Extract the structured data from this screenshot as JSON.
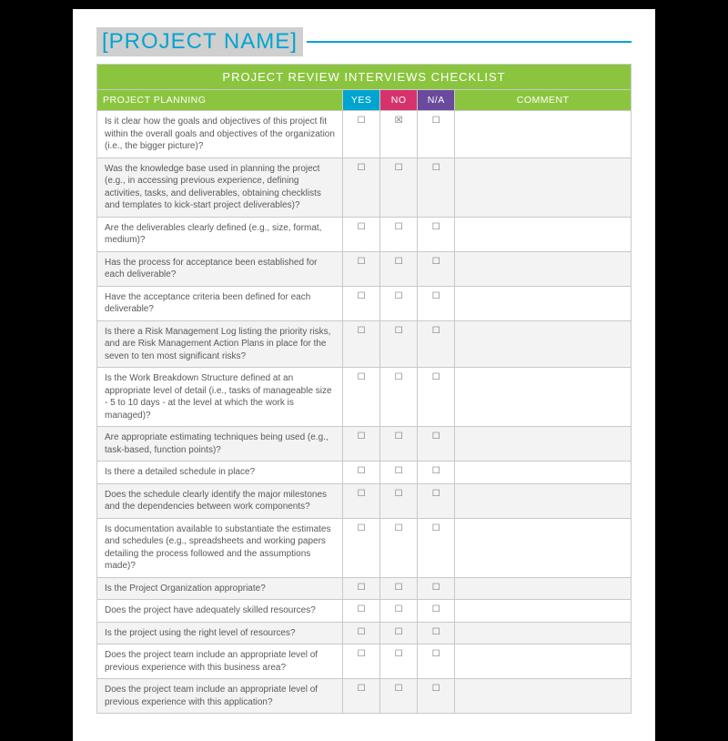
{
  "title": "[PROJECT NAME]",
  "banner": "PROJECT REVIEW INTERVIEWS CHECKLIST",
  "headers": {
    "section": "PROJECT PLANNING",
    "yes": "YES",
    "no": "NO",
    "na": "N/A",
    "comment": "COMMENT"
  },
  "glyphs": {
    "unchecked": "☐",
    "checked": "☒"
  },
  "rows": [
    {
      "q": "Is it clear how the goals and objectives of this project fit within the overall goals and objectives of the organization (i.e., the bigger picture)?",
      "yes": false,
      "no": true,
      "na": false,
      "alt": false
    },
    {
      "q": "Was the knowledge base used in planning the project (e.g., in accessing previous experience, defining activities, tasks, and deliverables, obtaining checklists and templates to kick-start project deliverables)?",
      "yes": false,
      "no": false,
      "na": false,
      "alt": true
    },
    {
      "q": "Are the deliverables clearly defined (e.g., size, format, medium)?",
      "yes": false,
      "no": false,
      "na": false,
      "alt": false
    },
    {
      "q": "Has the process for acceptance been established for each deliverable?",
      "yes": false,
      "no": false,
      "na": false,
      "alt": true
    },
    {
      "q": "Have the acceptance criteria been defined for each deliverable?",
      "yes": false,
      "no": false,
      "na": false,
      "alt": false
    },
    {
      "q": "Is there a Risk Management Log listing the priority risks, and are Risk Management Action Plans in place for the seven to ten most significant risks?",
      "yes": false,
      "no": false,
      "na": false,
      "alt": true
    },
    {
      "q": "Is the Work Breakdown Structure defined at an appropriate level of detail (i.e., tasks of manageable size - 5 to 10 days - at the level at which the work is managed)?",
      "yes": false,
      "no": false,
      "na": false,
      "alt": false
    },
    {
      "q": "Are appropriate estimating techniques being used (e.g., task-based, function points)?",
      "yes": false,
      "no": false,
      "na": false,
      "alt": true
    },
    {
      "q": "Is there a detailed schedule in place?",
      "yes": false,
      "no": false,
      "na": false,
      "alt": false
    },
    {
      "q": "Does the schedule clearly identify the major milestones and the dependencies between work components?",
      "yes": false,
      "no": false,
      "na": false,
      "alt": true
    },
    {
      "q": "Is documentation available to substantiate the estimates and schedules (e.g., spreadsheets and working papers detailing the process followed and the assumptions made)?",
      "yes": false,
      "no": false,
      "na": false,
      "alt": false
    },
    {
      "q": "Is the Project Organization appropriate?",
      "yes": false,
      "no": false,
      "na": false,
      "alt": true
    },
    {
      "q": "Does the project have adequately skilled resources?",
      "yes": false,
      "no": false,
      "na": false,
      "alt": false
    },
    {
      "q": "Is the project using the right level of resources?",
      "yes": false,
      "no": false,
      "na": false,
      "alt": true
    },
    {
      "q": "Does the project team include an appropriate level of previous experience with this business area?",
      "yes": false,
      "no": false,
      "na": false,
      "alt": false
    },
    {
      "q": "Does the project team include an appropriate level of previous experience with this application?",
      "yes": false,
      "no": false,
      "na": false,
      "alt": true
    }
  ]
}
